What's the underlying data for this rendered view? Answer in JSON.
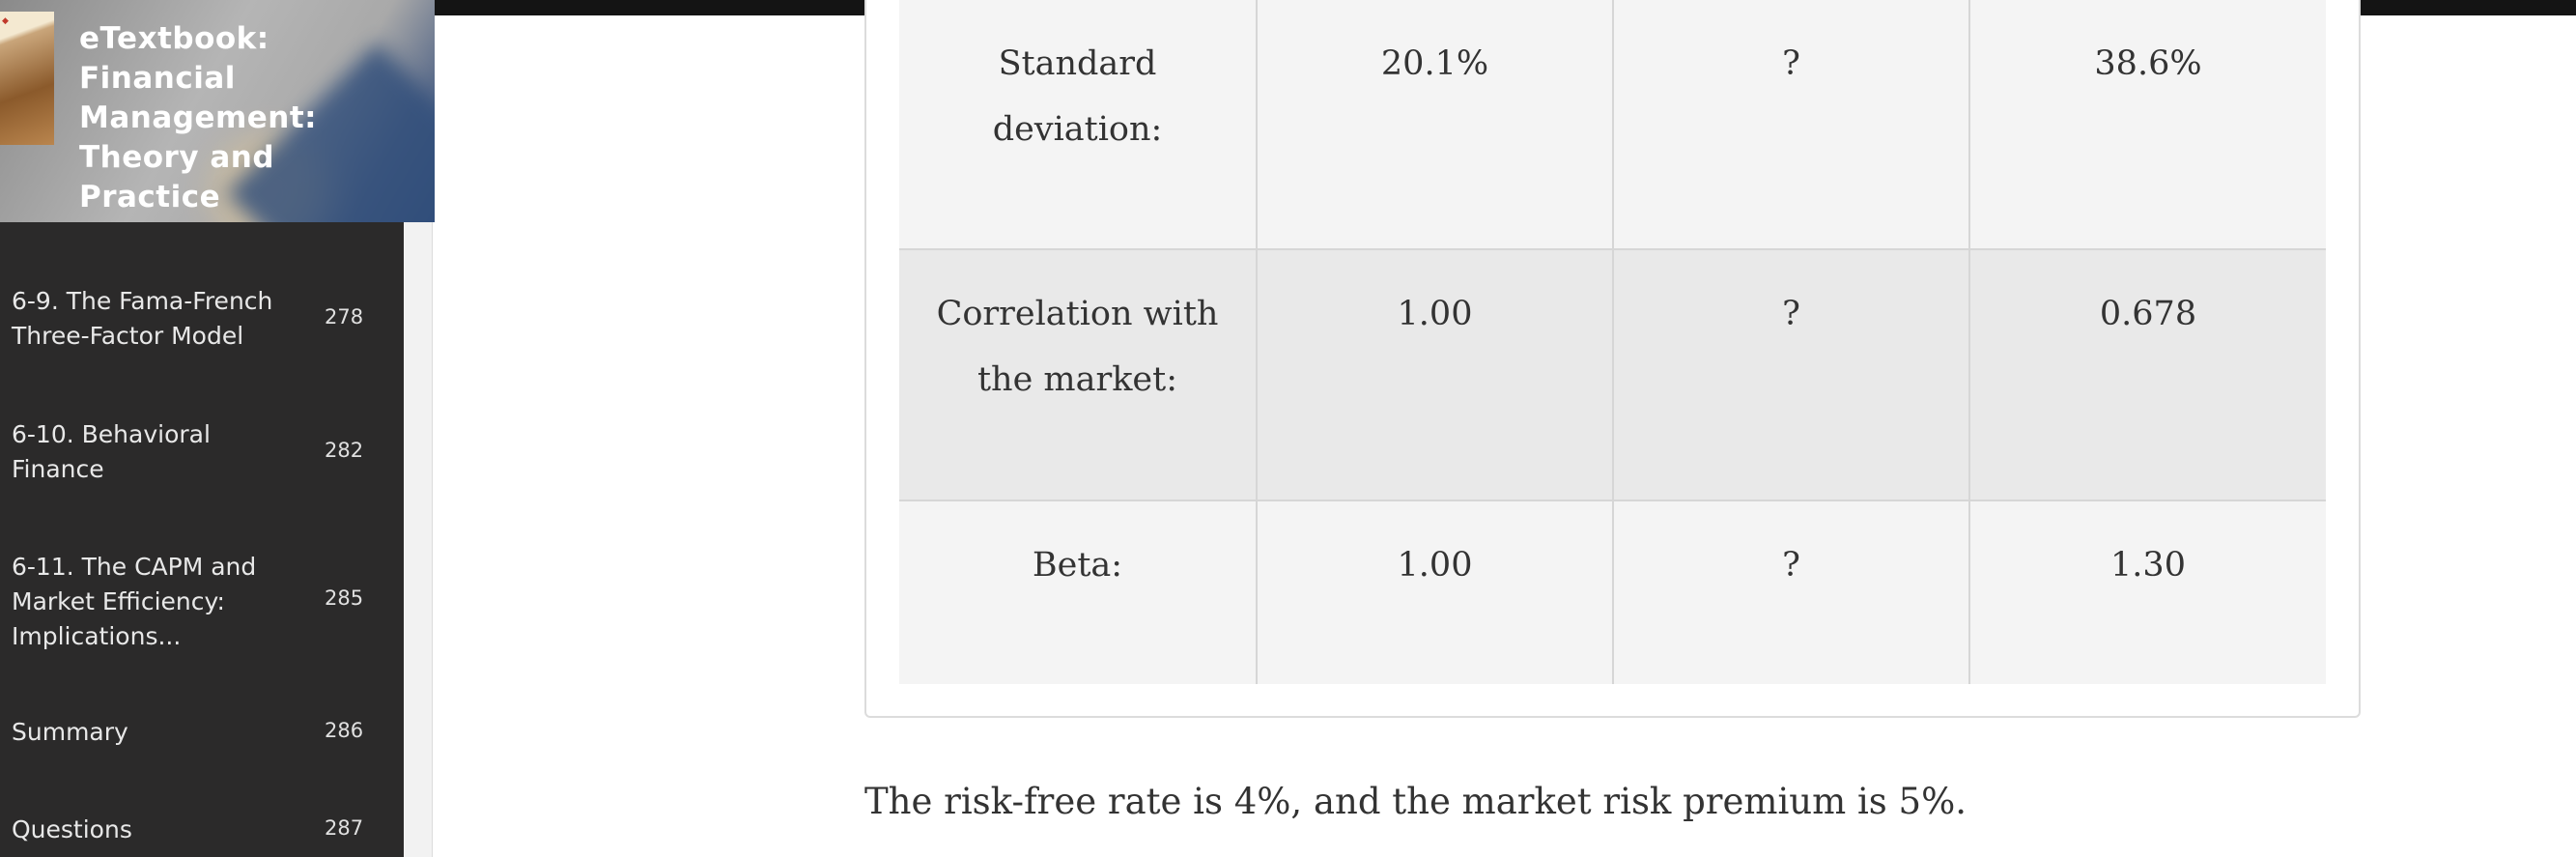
{
  "book": {
    "title": "eTextbook: Financial Management: Theory and Practice"
  },
  "toc": [
    {
      "label": "6-9. The Fama-French Three-Factor Model",
      "page": "278"
    },
    {
      "label": "6-10. Behavioral Finance",
      "page": "282"
    },
    {
      "label": "6-11. The CAPM and Market Efficiency: Implications...",
      "page": "285"
    },
    {
      "label": "Summary",
      "page": "286"
    },
    {
      "label": "Questions",
      "page": "287"
    }
  ],
  "table": {
    "rows": [
      [
        "Standard deviation:",
        "20.1%",
        "?",
        "38.6%"
      ],
      [
        "Correlation with the market:",
        "1.00",
        "?",
        "0.678"
      ],
      [
        "Beta:",
        "1.00",
        "?",
        "1.30"
      ]
    ]
  },
  "body_text": "The risk-free rate is 4%, and the market risk premium is 5%.",
  "colors": {
    "sidebar_bg": "#2b2a2a",
    "row_light": "#f4f4f4",
    "row_dark": "#e9e9e9",
    "text": "#333333"
  }
}
